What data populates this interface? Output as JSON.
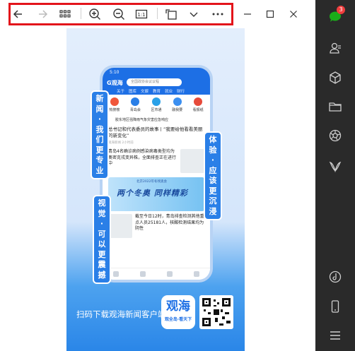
{
  "toolbar": {
    "back": "back-icon",
    "forward": "forward-icon",
    "grid": "grid-icon",
    "zoom_in": "zoom-in-icon",
    "zoom_out": "zoom-out-icon",
    "actual_size": "1:1",
    "rotate": "rotate-icon",
    "more_menu": "chevron-down-icon",
    "more": "more-icon"
  },
  "window": {
    "minimize": "minimize-icon",
    "maximize": "maximize-icon",
    "close": "close-icon"
  },
  "poster": {
    "label_news": [
      "新",
      "闻",
      "·",
      "我",
      "们",
      "更",
      "专",
      "业"
    ],
    "label_experience": [
      "体",
      "验",
      "·",
      "应",
      "该",
      "更",
      "沉",
      "浸"
    ],
    "label_visual": [
      "视",
      "觉",
      "·",
      "可",
      "以",
      "更",
      "震",
      "撼"
    ],
    "download_text": "扫码下载观海新闻客户端",
    "app_logo_title": "观海",
    "app_logo_slogan": "观全岛·看天下",
    "phone": {
      "time": "5:10",
      "logo": "G观海",
      "search_placeholder": "全国政协会议议程",
      "tabs": [
        "关于",
        "图库",
        "文娱",
        "教育",
        "就业",
        "财行"
      ],
      "icons": [
        "热搜榜",
        "青岛会",
        "区市通",
        "融我要",
        "看报纸"
      ],
      "notice": "胶东地区强降雨气象灾害应急响应",
      "headline": "总书记和代表委员的故事丨“我要给他看看美丽的新变化”",
      "headline_meta": "观海新闻  2小时前",
      "story1": "青岛4名确诊病例感染病毒类型均为奥密克戎变异株，全面排查正在进行中",
      "banner_top": "北京2022年冬残奥会",
      "banner_text": "两个冬奥 同样精彩",
      "story2": "截至今日12时，青岛排查检测其他重点人员25181人，核酸检测结果均为阴性"
    }
  },
  "sidebar": {
    "items": [
      "chat-icon",
      "contacts-icon",
      "box-icon",
      "folder-icon",
      "shutter-icon",
      "tulip-icon",
      "music-icon",
      "phone-icon",
      "menu-icon"
    ],
    "chat_badge": "3"
  },
  "colors": {
    "highlight": "#e3141b",
    "brand_blue": "#1d6fe5",
    "sidebar_bg": "#2a2a2a",
    "chat_green": "#1aad19"
  }
}
